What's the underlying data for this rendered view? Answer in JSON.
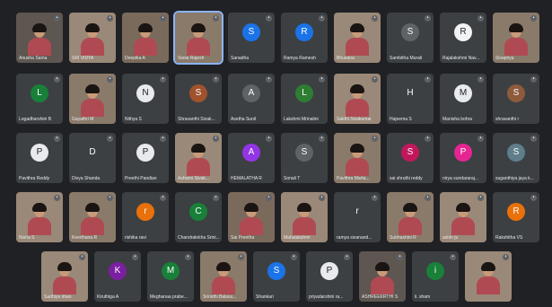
{
  "meeting": {
    "rows": [
      [
        {
          "name": "Anusha Sama",
          "type": "video",
          "tone": "v3",
          "muted": true
        },
        {
          "name": "SRI VIDYA",
          "type": "video",
          "tone": "v4",
          "muted": true
        },
        {
          "name": "Deepika A",
          "type": "video",
          "tone": "v1",
          "muted": true
        },
        {
          "name": "Vania Rajesh",
          "type": "video",
          "tone": "v2",
          "muted": false,
          "active": true
        },
        {
          "name": "Sanadha",
          "type": "avatar",
          "initial": "S",
          "color": "#1a73e8",
          "muted": true
        },
        {
          "name": "Ramya Ramesh",
          "type": "avatar",
          "initial": "R",
          "color": "#1a73e8",
          "muted": true
        },
        {
          "name": "Bhuvana",
          "type": "video",
          "tone": "v4",
          "muted": true
        },
        {
          "name": "Sambitha Murali",
          "type": "avatar",
          "initial": "S",
          "color": "#5f6368",
          "muted": true
        },
        {
          "name": "Rajalakshmi Nav...",
          "type": "avatar",
          "initial": "R",
          "color": "#f1f3f4",
          "text": "#202124",
          "muted": true
        },
        {
          "name": "Sivapriya",
          "type": "video",
          "tone": "v2",
          "muted": true
        }
      ],
      [
        {
          "name": "Logadharshini B",
          "type": "avatar",
          "initial": "L",
          "color": "#188038",
          "muted": true
        },
        {
          "name": "Gayathri M",
          "type": "video",
          "tone": "v2",
          "muted": true
        },
        {
          "name": "Nithya S",
          "type": "avatar",
          "initial": "N",
          "color": "#e8eaed",
          "text": "#202124",
          "muted": true
        },
        {
          "name": "Shravanthi Sivak...",
          "type": "avatar",
          "initial": "S",
          "color": "#a0522d",
          "muted": true
        },
        {
          "name": "Asetha Sunil",
          "type": "avatar",
          "initial": "A",
          "color": "#5f6368",
          "muted": true
        },
        {
          "name": "Lakshmi Mrinalini",
          "type": "avatar",
          "initial": "L",
          "color": "#2e7d32",
          "muted": true
        },
        {
          "name": "Sakthi Sivakumar",
          "type": "video",
          "tone": "v4",
          "muted": true
        },
        {
          "name": "Hajeema S",
          "type": "avatar",
          "initial": "H",
          "color": "#3c4043",
          "muted": true
        },
        {
          "name": "Manisha bohra",
          "type": "avatar",
          "initial": "M",
          "color": "#e8eaed",
          "text": "#202124",
          "muted": true
        },
        {
          "name": "shravanthi r",
          "type": "avatar",
          "initial": "S",
          "color": "#8d5a3c",
          "muted": true
        }
      ],
      [
        {
          "name": "Pavithra Reddy",
          "type": "avatar",
          "initial": "P",
          "color": "#e8eaed",
          "text": "#202124",
          "muted": true
        },
        {
          "name": "Divya Shanda",
          "type": "avatar",
          "initial": "D",
          "color": "#3c4043",
          "muted": true
        },
        {
          "name": "Preethi Pandian",
          "type": "avatar",
          "initial": "P",
          "color": "#e8eaed",
          "text": "#202124",
          "muted": true
        },
        {
          "name": "Ashwini Sivak...",
          "type": "video",
          "tone": "v4",
          "muted": true
        },
        {
          "name": "HEMALATHA R",
          "type": "avatar",
          "initial": "A",
          "color": "#9334e6",
          "muted": true
        },
        {
          "name": "Sonali T",
          "type": "avatar",
          "initial": "S",
          "color": "#5f6368",
          "muted": true
        },
        {
          "name": "Pavithra Marta...",
          "type": "video",
          "tone": "v2",
          "muted": true
        },
        {
          "name": "sai shruthi reddy",
          "type": "avatar",
          "initial": "S",
          "color": "#c2185b",
          "muted": true
        },
        {
          "name": "nirya sundararaj...",
          "type": "avatar",
          "initial": "P",
          "color": "#e52592",
          "muted": true
        },
        {
          "name": "suganthiya jaya k...",
          "type": "avatar",
          "initial": "S",
          "color": "#607d8b",
          "muted": true
        }
      ],
      [
        {
          "name": "Nisha S",
          "type": "video",
          "tone": "v4",
          "muted": true
        },
        {
          "name": "Keerthana R",
          "type": "video",
          "tone": "v2",
          "muted": true
        },
        {
          "name": "rishika ravi",
          "type": "avatar",
          "initial": "r",
          "color": "#e8710a",
          "muted": true
        },
        {
          "name": "Chandralekha Srini...",
          "type": "avatar",
          "initial": "C",
          "color": "#188038",
          "muted": true
        },
        {
          "name": "Sai Preetha",
          "type": "video",
          "tone": "v1",
          "muted": true
        },
        {
          "name": "Mahalakshmi",
          "type": "video",
          "tone": "v4",
          "muted": true
        },
        {
          "name": "ramya sivanand...",
          "type": "avatar",
          "initial": "r",
          "color": "#3c4043",
          "muted": true
        },
        {
          "name": "Subhashini R",
          "type": "video",
          "tone": "v2",
          "muted": true
        },
        {
          "name": "ashin ju",
          "type": "video",
          "tone": "v4",
          "muted": true
        },
        {
          "name": "Rakshitha VS",
          "type": "avatar",
          "initial": "R",
          "color": "#e8710a",
          "muted": true
        }
      ],
      [
        {
          "name": "Sadhiya Iman",
          "type": "video",
          "tone": "v4",
          "muted": true
        },
        {
          "name": "Kiruthiga A",
          "type": "avatar",
          "initial": "K",
          "color": "#7b1fa2",
          "muted": true
        },
        {
          "name": "Meghanaa prabe...",
          "type": "avatar",
          "initial": "M",
          "color": "#188038",
          "muted": true
        },
        {
          "name": "Srinidhi Balasu...",
          "type": "video",
          "tone": "v2",
          "muted": true
        },
        {
          "name": "Shankari",
          "type": "avatar",
          "initial": "S",
          "color": "#1a73e8",
          "muted": true
        },
        {
          "name": "priyadarshini ra...",
          "type": "avatar",
          "initial": "P",
          "color": "#e8eaed",
          "text": "#202124",
          "muted": true
        },
        {
          "name": "ASHREEKRTHI S",
          "type": "video",
          "tone": "v3",
          "muted": true
        },
        {
          "name": "ii. sham",
          "type": "avatar",
          "initial": "i",
          "color": "#188038",
          "muted": true
        },
        {
          "name": "",
          "type": "video",
          "tone": "v4",
          "muted": true
        }
      ]
    ]
  }
}
